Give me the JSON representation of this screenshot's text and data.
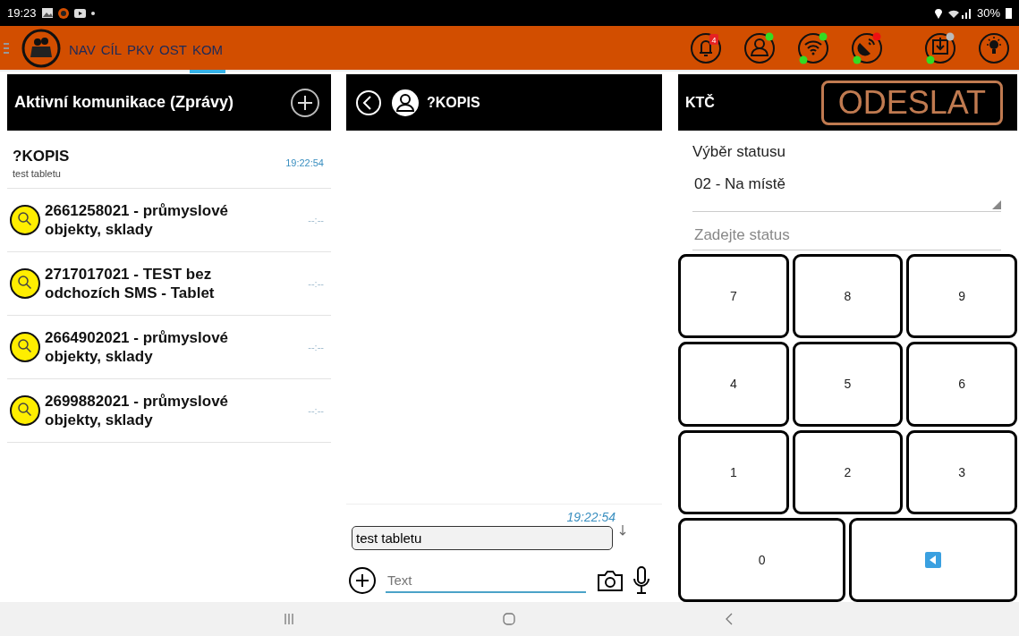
{
  "status_bar": {
    "time": "19:23",
    "battery": "30%"
  },
  "tabs": [
    {
      "label": "NAV",
      "selected": false
    },
    {
      "label": "CÍL",
      "selected": false
    },
    {
      "label": "PKV",
      "selected": false
    },
    {
      "label": "OST",
      "selected": false
    },
    {
      "label": "KOM",
      "selected": true
    }
  ],
  "toolbar_icons": [
    {
      "kind": "bell",
      "badge": "4"
    },
    {
      "kind": "person",
      "top_dot": {
        "color": "#33dd22"
      }
    },
    {
      "kind": "wifi",
      "top_dot": {
        "color": "#33dd22"
      },
      "bottom_dot": {
        "color": "#33dd22"
      }
    },
    {
      "kind": "satellite",
      "top_dot": {
        "color": "#ee1111"
      },
      "bottom_dot": {
        "color": "#33dd22"
      }
    },
    {
      "kind": "download",
      "top_dot": {
        "color": "#bbbbbb"
      },
      "bottom_dot": {
        "color": "#33dd22"
      }
    },
    {
      "kind": "bulb"
    }
  ],
  "conversations": {
    "title": "Aktivní komunikace (Zprávy)",
    "items": [
      {
        "kind": "chat",
        "title": "?KOPIS",
        "subtitle": "test tabletu",
        "time": "19:22:54"
      },
      {
        "kind": "incident",
        "title": "2661258021 - průmyslové objekty, sklady",
        "time": "--:--"
      },
      {
        "kind": "incident",
        "title": "2717017021 - TEST bez odchozích SMS - Tablet",
        "time": "--:--"
      },
      {
        "kind": "incident",
        "title": "2664902021 - průmyslové objekty, sklady",
        "time": "--:--"
      },
      {
        "kind": "incident",
        "title": "2699882021 - průmyslové objekty, sklady",
        "time": "--:--"
      }
    ]
  },
  "chat": {
    "title": "?KOPIS",
    "messages": [
      {
        "time": "19:22:54",
        "text": "test tabletu"
      }
    ],
    "input": {
      "placeholder": "Text"
    }
  },
  "status_panel": {
    "title": "KTČ",
    "send_button": "ODESLAT",
    "label": "Výběr statusu",
    "selected_status": "02 - Na místě",
    "status_input": {
      "placeholder": "Zadejte status"
    },
    "keys": [
      {
        "kind": "digit",
        "label": "7"
      },
      {
        "kind": "digit",
        "label": "8"
      },
      {
        "kind": "digit",
        "label": "9"
      },
      {
        "kind": "digit",
        "label": "4"
      },
      {
        "kind": "digit",
        "label": "5"
      },
      {
        "kind": "digit",
        "label": "6"
      },
      {
        "kind": "digit",
        "label": "1"
      },
      {
        "kind": "digit",
        "label": "2"
      },
      {
        "kind": "digit",
        "label": "3"
      },
      {
        "kind": "wide",
        "label": "0"
      },
      {
        "kind": "backspace"
      }
    ]
  }
}
